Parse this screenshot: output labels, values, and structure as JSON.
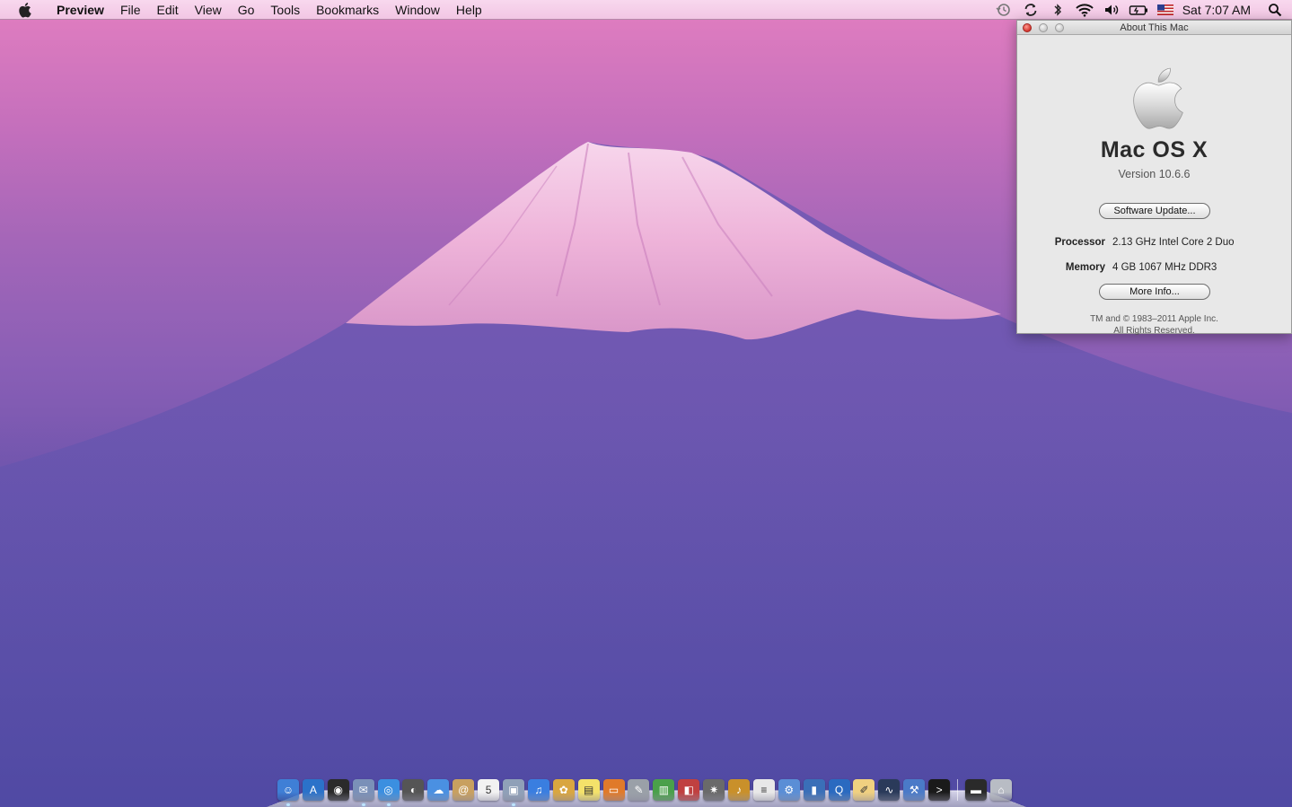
{
  "menubar": {
    "app_name": "Preview",
    "menus": [
      "File",
      "Edit",
      "View",
      "Go",
      "Tools",
      "Bookmarks",
      "Window",
      "Help"
    ],
    "clock": "Sat 7:07 AM",
    "status_icons": [
      "time-machine-icon",
      "sync-icon",
      "bluetooth-icon",
      "wifi-icon",
      "volume-icon",
      "battery-icon",
      "input-flag-icon",
      "spotlight-icon"
    ]
  },
  "about_window": {
    "title": "About This Mac",
    "os_name": "Mac OS X",
    "version": "Version 10.6.6",
    "software_update_label": "Software Update...",
    "processor_label": "Processor",
    "processor_value": "2.13 GHz Intel Core 2 Duo",
    "memory_label": "Memory",
    "memory_value": "4 GB 1067 MHz DDR3",
    "more_info_label": "More Info...",
    "copyright_line1": "TM and © 1983–2011 Apple Inc.",
    "copyright_line2": "All Rights Reserved."
  },
  "dock": {
    "apps": [
      {
        "name": "finder-icon",
        "color": "#3f7fd6",
        "glyph": "☺",
        "running": true
      },
      {
        "name": "app-store-icon",
        "color": "#2b72c9",
        "glyph": "A",
        "running": false
      },
      {
        "name": "dashboard-icon",
        "color": "#2a2a2a",
        "glyph": "◉",
        "running": false
      },
      {
        "name": "mail-stamp-icon",
        "color": "#7a90b8",
        "glyph": "✉",
        "running": true
      },
      {
        "name": "safari-icon",
        "color": "#3b8fe0",
        "glyph": "◎",
        "running": true
      },
      {
        "name": "facetime-icon",
        "color": "#555",
        "glyph": "◐",
        "running": false
      },
      {
        "name": "ichat-icon",
        "color": "#4a90e2",
        "glyph": "☁",
        "running": false
      },
      {
        "name": "address-book-icon",
        "color": "#c8a060",
        "glyph": "@",
        "running": false
      },
      {
        "name": "ical-icon",
        "color": "#f2f2f2",
        "glyph": "5",
        "running": false
      },
      {
        "name": "preview-icon",
        "color": "#8fa0b8",
        "glyph": "▣",
        "running": true
      },
      {
        "name": "itunes-icon",
        "color": "#3a7ee0",
        "glyph": "♫",
        "running": false
      },
      {
        "name": "iphoto-icon",
        "color": "#d9a640",
        "glyph": "✿",
        "running": false
      },
      {
        "name": "stickies-icon",
        "color": "#f4e26a",
        "glyph": "▤",
        "running": false
      },
      {
        "name": "keynote-icon",
        "color": "#e07a2a",
        "glyph": "▭",
        "running": false
      },
      {
        "name": "script-editor-icon",
        "color": "#9aa0a8",
        "glyph": "✎",
        "running": false
      },
      {
        "name": "numbers-icon",
        "color": "#4aa04a",
        "glyph": "▥",
        "running": false
      },
      {
        "name": "photo-booth-icon",
        "color": "#c04040",
        "glyph": "◧",
        "running": false
      },
      {
        "name": "imovie-icon",
        "color": "#6a6a6a",
        "glyph": "✷",
        "running": false
      },
      {
        "name": "garageband-icon",
        "color": "#c9902a",
        "glyph": "♪",
        "running": false
      },
      {
        "name": "textedit-icon",
        "color": "#e8e8e8",
        "glyph": "≡",
        "running": false
      },
      {
        "name": "utilities-folder-icon",
        "color": "#5a8ed6",
        "glyph": "⚙",
        "running": false
      },
      {
        "name": "books-icon",
        "color": "#3a6fb8",
        "glyph": "▮",
        "running": false
      },
      {
        "name": "quicktime-icon",
        "color": "#2a6ac0",
        "glyph": "Q",
        "running": false
      },
      {
        "name": "pages-icon",
        "color": "#f0d080",
        "glyph": "✐",
        "running": false
      },
      {
        "name": "activity-monitor-icon",
        "color": "#2a3a5a",
        "glyph": "∿",
        "running": false
      },
      {
        "name": "xcode-icon",
        "color": "#4a7ac8",
        "glyph": "⚒",
        "running": false
      },
      {
        "name": "terminal-icon",
        "color": "#1a1a1a",
        "glyph": ">",
        "running": false
      }
    ],
    "stack_items": [
      {
        "name": "downloads-stack-icon",
        "color": "#2a2a2a",
        "glyph": "▬"
      },
      {
        "name": "trash-icon",
        "color": "#b8bcc4",
        "glyph": "⌂"
      }
    ]
  }
}
